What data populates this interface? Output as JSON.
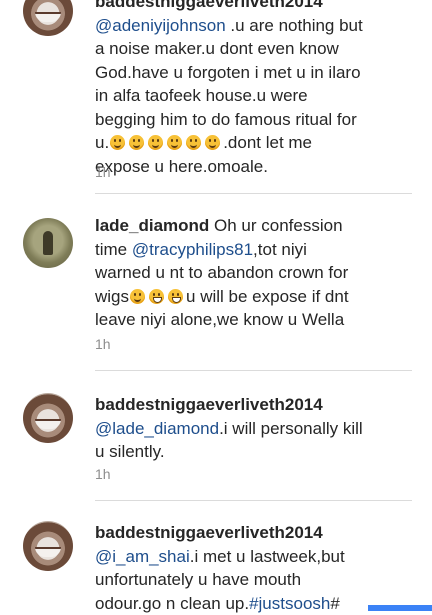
{
  "comments": [
    {
      "username": "baddestniggaeverliveth2014",
      "lines": [
        {
          "mention": "@adeniyijohnson",
          "text": " .u are nothing but"
        },
        {
          "text": "a noise maker.u dont even know"
        },
        {
          "text": "God.have u forgoten i met u in ilaro"
        },
        {
          "text": "in alfa taofeek house.u were"
        },
        {
          "text": "begging him to do famous ritual for"
        },
        {
          "text_before": "u.",
          "text_after": ".dont let me"
        },
        {
          "text": "expose u here.omoale."
        }
      ],
      "time": "1h"
    },
    {
      "username": "lade_diamond",
      "line1_text": " Oh ur confession",
      "line2_text_before": "time ",
      "line2_mention": "@tracyphilips81",
      "line2_text_after": ",tot niyi",
      "line3": "warned u nt to abandon crown for",
      "line4_before": "wigs",
      "line4_after": "u will be expose if dnt",
      "line5": "leave niyi alone,we know u Wella",
      "time": "1h"
    },
    {
      "username": "baddestniggaeverliveth2014",
      "mention": "@lade_diamond",
      "text1": ".i will personally kill",
      "text2": "u silently.",
      "time": "1h"
    },
    {
      "username": "baddestniggaeverliveth2014",
      "mention": "@i_am_shai",
      "text1": ".i met u lastweek,but",
      "text2": "unfortunately u have mouth",
      "text3_before": "odour.go n clean up.",
      "hashtag": "#justsoosh",
      "text3_after": "#"
    }
  ]
}
